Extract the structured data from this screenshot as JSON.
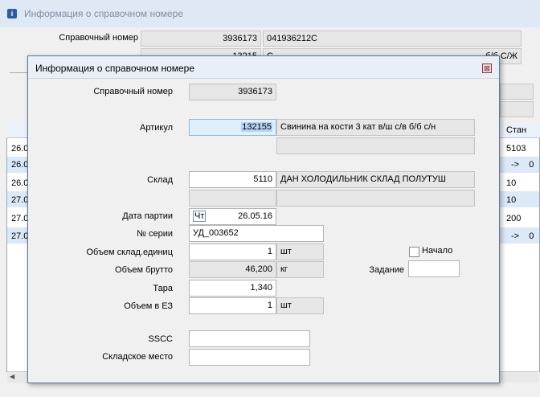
{
  "background_window": {
    "title": "Информация о справочном номере",
    "icon": "info-icon",
    "ref_label": "Справочный номер",
    "ref_number": "3936173",
    "ref_code": "041936212C",
    "article_partial": "13215",
    "name_partial": "С",
    "name_tail_partial": "б/б С/Ж",
    "grid": {
      "visible_header": "Стан",
      "left_cells": [
        "26.0",
        "26.0",
        "26.0",
        "27.0",
        "27.0",
        "27.0"
      ],
      "right_cells": [
        "5103",
        "->    0",
        "10",
        "10",
        "200",
        "->    0"
      ]
    }
  },
  "dialog": {
    "title": "Информация о справочном номере",
    "close_glyph": "⊠",
    "labels": {
      "ref": "Справочный номер",
      "article": "Артикул",
      "warehouse": "Склад",
      "batch_date": "Дата партии",
      "serial": "№ серии",
      "vol_units": "Объем склад.единиц",
      "vol_gross": "Объем брутто",
      "tare": "Тара",
      "vol_ez": "Объем в ЕЗ",
      "start": "Начало",
      "task": "Задание",
      "sscc": "SSCC",
      "location": "Складское место"
    },
    "values": {
      "ref": "3936173",
      "article": "132155",
      "article_name": "Свинина на кости 3 кат в/ш с/в б/б с/н",
      "article_extra": "",
      "warehouse": "5110",
      "warehouse_name": "ДАН ХОЛОДИЛЬНИК СКЛАД ПОЛУТУШ",
      "warehouse_extra_1": "",
      "warehouse_extra_2": "",
      "batch_day": "Чт",
      "batch_date": "26.05.16",
      "serial": "УД_003652",
      "vol_units": "1",
      "vol_units_unit": "шт",
      "vol_gross": "46,200",
      "vol_gross_unit": "кг",
      "tare": "1,340",
      "vol_ez": "1",
      "vol_ez_unit": "шт",
      "task": "",
      "sscc": "",
      "location": ""
    },
    "start_checked": false
  }
}
